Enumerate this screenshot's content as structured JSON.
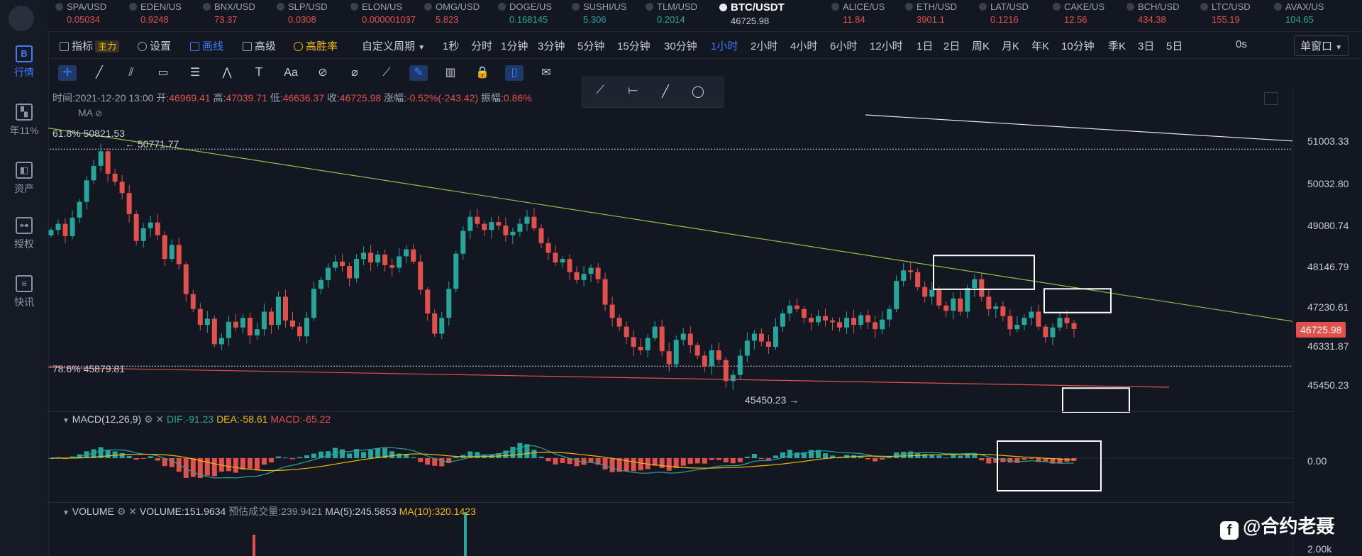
{
  "sidebar": {
    "items": [
      {
        "label": "行情",
        "active": true,
        "icon": "B"
      },
      {
        "label": "年11%",
        "active": false,
        "icon": "▚"
      },
      {
        "label": "资产",
        "active": false,
        "icon": "◧"
      },
      {
        "label": "授权",
        "active": false,
        "icon": "⊶"
      },
      {
        "label": "快讯",
        "active": false,
        "icon": "≡"
      }
    ]
  },
  "tickers": [
    {
      "sym": "SPA/USD",
      "px": "0.05034",
      "dir": "down"
    },
    {
      "sym": "EDEN/US",
      "px": "0.9248",
      "dir": "down"
    },
    {
      "sym": "BNX/USD",
      "px": "73.37",
      "dir": "down"
    },
    {
      "sym": "SLP/USD",
      "px": "0.0308",
      "dir": "down"
    },
    {
      "sym": "ELON/US",
      "px": "0.000001037",
      "dir": "down"
    },
    {
      "sym": "OMG/USD",
      "px": "5.823",
      "dir": "down"
    },
    {
      "sym": "DOGE/US",
      "px": "0.168145",
      "dir": "up"
    },
    {
      "sym": "SUSHI/US",
      "px": "5.306",
      "dir": "up"
    },
    {
      "sym": "TLM/USD",
      "px": "0.2014",
      "dir": "up"
    },
    {
      "sym": "BTC/USDT",
      "px": "46725.98",
      "dir": "main"
    },
    {
      "sym": "ALICE/US",
      "px": "11.84",
      "dir": "down"
    },
    {
      "sym": "ETH/USD",
      "px": "3901.1",
      "dir": "down"
    },
    {
      "sym": "LAT/USD",
      "px": "0.1216",
      "dir": "down"
    },
    {
      "sym": "CAKE/US",
      "px": "12.56",
      "dir": "down"
    },
    {
      "sym": "BCH/USD",
      "px": "434.38",
      "dir": "down"
    },
    {
      "sym": "LTC/USD",
      "px": "155.19",
      "dir": "down"
    },
    {
      "sym": "AVAX/US",
      "px": "104.65",
      "dir": "up"
    }
  ],
  "toolbar": {
    "indicator": "指标",
    "indicator_badge": "主力",
    "settings": "设置",
    "drawline": "画线",
    "advanced": "高级",
    "winrate": "高胜率",
    "custom_period": "自定义周期",
    "periods": [
      "1秒",
      "分时",
      "1分钟",
      "3分钟",
      "5分钟",
      "15分钟",
      "30分钟",
      "1小时",
      "2小时",
      "4小时",
      "6小时",
      "12小时",
      "1日",
      "2日",
      "周K",
      "月K",
      "年K",
      "10分钟",
      "季K",
      "3日",
      "5日"
    ],
    "active_period": "1小时",
    "countdown": "0s",
    "window_mode": "单窗口"
  },
  "drawtools": [
    "cross-icon",
    "line-icon",
    "parallel-icon",
    "rect-icon",
    "hlines-icon",
    "wave-icon",
    "text-icon",
    "font-icon",
    "magnet-icon",
    "eraser-icon",
    "ruler-icon",
    "pen-icon",
    "candle-icon",
    "lock-icon",
    "bookmark-icon",
    "note-icon"
  ],
  "subtools": [
    "ray-line-icon",
    "horizontal-line-icon",
    "segment-icon",
    "ellipse-icon"
  ],
  "ohlc": {
    "time_label": "时间:",
    "time": "2021-12-20 13:00",
    "open_label": "开:",
    "open": "46969.41",
    "high_label": "高:",
    "high": "47039.71",
    "low_label": "低:",
    "low": "46636.37",
    "close_label": "收:",
    "close": "46725.98",
    "chg_label": "涨幅:",
    "chg": "-0.52%(-243.42)",
    "amp_label": "振幅:",
    "amp": "0.86%"
  },
  "ma_label": "MA",
  "fib": {
    "top": "61.8% 50821.53",
    "bottom": "78.6% 45879.81",
    "high_mark": "← 50771.77",
    "low_mark": "45450.23 →"
  },
  "price_axis": [
    "51003.33",
    "50032.80",
    "49080.74",
    "48146.79",
    "47230.61",
    "46331.87",
    "45450.23",
    "0.00",
    "2.00k"
  ],
  "last_price": "46725.98",
  "macd": {
    "title": "MACD(12,26,9)",
    "dif": "DIF:-91.23",
    "dea": "DEA:-58.61",
    "macd": "MACD:-65.22"
  },
  "volume": {
    "title": "VOLUME",
    "value": "VOLUME:151.9634",
    "est": "预估成交量:239.9421",
    "ma5": "MA(5):245.5853",
    "ma10": "MA(10):320.1423"
  },
  "watermark": "@合约老聂",
  "chart_data": {
    "type": "candlestick",
    "timeframe": "1小时",
    "ylim": [
      44900,
      51600
    ],
    "closes": [
      48980,
      49120,
      48840,
      49260,
      49620,
      50110,
      50440,
      50771,
      50260,
      50080,
      49820,
      49340,
      48730,
      49020,
      49150,
      48860,
      48320,
      48640,
      48200,
      47520,
      47180,
      46820,
      46960,
      46380,
      46520,
      46890,
      46760,
      46980,
      46580,
      46720,
      47120,
      46820,
      47460,
      46920,
      46780,
      46560,
      46980,
      47640,
      47840,
      48120,
      48260,
      48160,
      47880,
      48320,
      48460,
      48240,
      48420,
      48180,
      48120,
      48380,
      48540,
      48260,
      47620,
      47080,
      46620,
      46980,
      47640,
      48440,
      48960,
      49280,
      49120,
      48980,
      49160,
      49080,
      48860,
      48940,
      49120,
      49280,
      49020,
      48680,
      48460,
      48240,
      48320,
      48020,
      47840,
      47980,
      48120,
      47860,
      47280,
      46980,
      46780,
      46540,
      46320,
      46240,
      46520,
      46780,
      46220,
      45920,
      46480,
      46620,
      46360,
      46120,
      45880,
      46240,
      46020,
      45540,
      45680,
      46120,
      46460,
      46620,
      46440,
      46320,
      46780,
      47080,
      47260,
      47180,
      46980,
      46880,
      47020,
      46920,
      46880,
      46760,
      46980,
      46820,
      47040,
      46880,
      46720,
      46940,
      47180,
      47820,
      48060,
      48020,
      47680,
      47460,
      47620,
      47260,
      47140,
      47420,
      47120,
      47660,
      47860,
      47460,
      47180,
      47240,
      47020,
      46720,
      46820,
      46980,
      47120,
      46780,
      46540,
      46760,
      46980,
      46860,
      46726
    ],
    "swing_high": 50771.77,
    "swing_low": 45450.23,
    "fib_levels": [
      {
        "pct": "61.8%",
        "price": 50821.53
      },
      {
        "pct": "78.6%",
        "price": 45879.81
      }
    ]
  }
}
